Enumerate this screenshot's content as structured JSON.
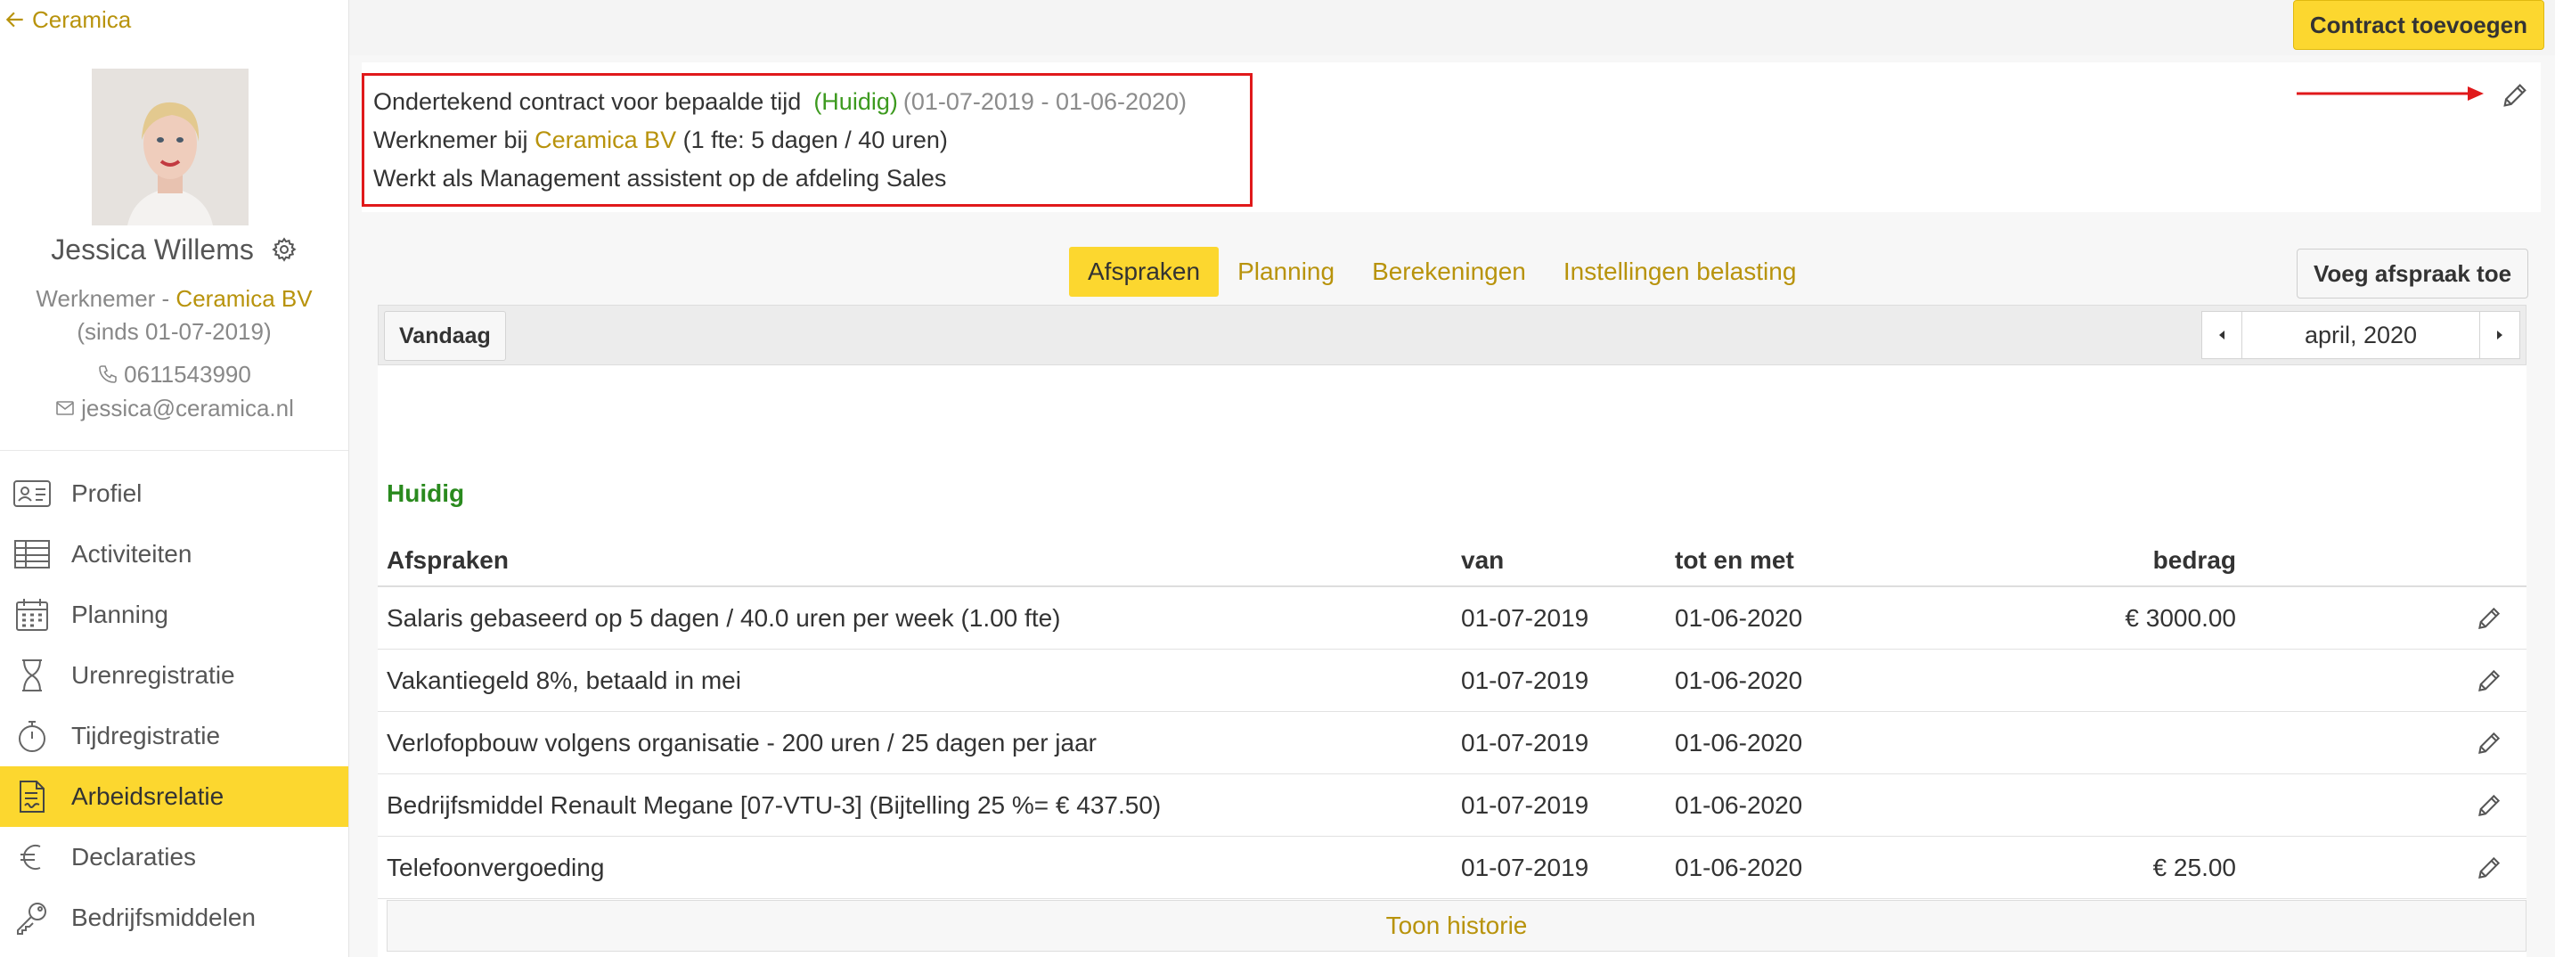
{
  "sidebar": {
    "back_label": "Ceramica",
    "profile": {
      "name": "Jessica Willems",
      "role": "Werknemer",
      "role_separator": " - ",
      "company": "Ceramica BV",
      "since": "(sinds 01-07-2019)",
      "phone": "0611543990",
      "email": "jessica@ceramica.nl"
    },
    "nav": [
      {
        "label": "Profiel",
        "icon": "id-card-icon"
      },
      {
        "label": "Activiteiten",
        "icon": "table-icon"
      },
      {
        "label": "Planning",
        "icon": "calendar-icon"
      },
      {
        "label": "Urenregistratie",
        "icon": "hourglass-icon"
      },
      {
        "label": "Tijdregistratie",
        "icon": "stopwatch-icon"
      },
      {
        "label": "Arbeidsrelatie",
        "icon": "contract-document-icon",
        "active": true
      },
      {
        "label": "Declaraties",
        "icon": "euro-icon"
      },
      {
        "label": "Bedrijfsmiddelen",
        "icon": "key-icon"
      }
    ]
  },
  "topbar": {
    "add_contract_label": "Contract toevoegen"
  },
  "contract": {
    "title": "Ondertekend contract voor bepaalde tijd",
    "status": "(Huidig)",
    "date_range": "(01-07-2019 - 01-06-2020)",
    "employer_prefix": "Werknemer bij",
    "employer": "Ceramica BV",
    "fte_text": "(1 fte: 5 dagen / 40 uren)",
    "role_text": "Werkt als Management assistent op de afdeling Sales"
  },
  "tabs": [
    {
      "label": "Afspraken",
      "active": true
    },
    {
      "label": "Planning"
    },
    {
      "label": "Berekeningen"
    },
    {
      "label": "Instellingen belasting"
    }
  ],
  "add_agreement_label": "Voeg afspraak toe",
  "toolbar": {
    "today_label": "Vandaag",
    "month_label": "april, 2020"
  },
  "agreements": {
    "section_title": "Huidig",
    "headers": {
      "description": "Afspraken",
      "from": "van",
      "to": "tot en met",
      "amount": "bedrag"
    },
    "rows": [
      {
        "description": "Salaris gebaseerd op 5 dagen / 40.0 uren per week (1.00 fte)",
        "from": "01-07-2019",
        "to": "01-06-2020",
        "amount": "€ 3000.00"
      },
      {
        "description": "Vakantiegeld 8%, betaald in mei",
        "from": "01-07-2019",
        "to": "01-06-2020",
        "amount": ""
      },
      {
        "description": "Verlofopbouw volgens organisatie - 200 uren / 25 dagen per jaar",
        "from": "01-07-2019",
        "to": "01-06-2020",
        "amount": ""
      },
      {
        "description": "Bedrijfsmiddel Renault Megane [07-VTU-3] (Bijtelling 25 %= € 437.50)",
        "from": "01-07-2019",
        "to": "01-06-2020",
        "amount": ""
      },
      {
        "description": "Telefoonvergoeding",
        "from": "01-07-2019",
        "to": "01-06-2020",
        "amount": "€ 25.00"
      }
    ],
    "history_label": "Toon historie"
  },
  "colors": {
    "accent_yellow": "#fcd72f",
    "link_gold": "#b8930c",
    "status_green": "#3d9a1f",
    "highlight_red": "#e0191b"
  }
}
